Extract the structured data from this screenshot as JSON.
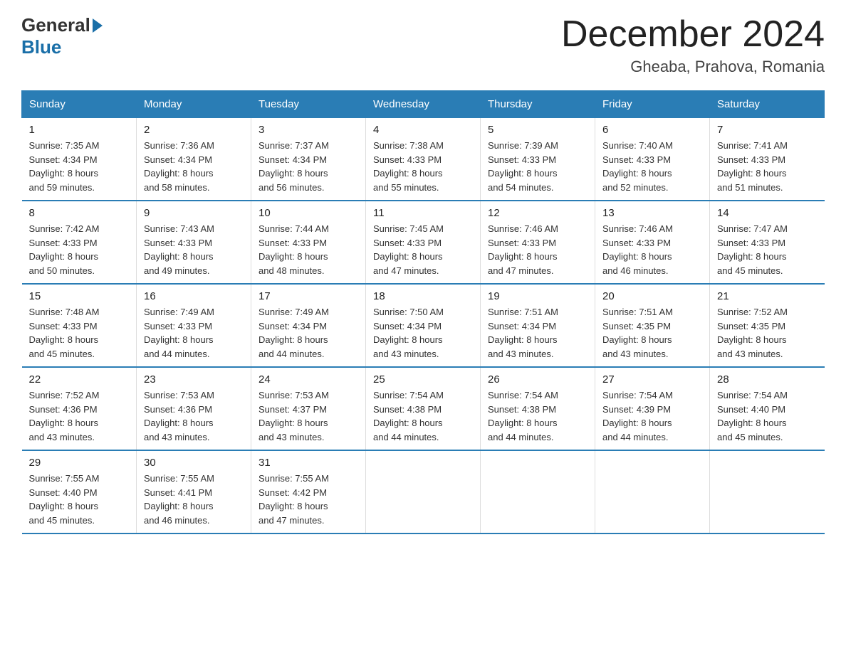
{
  "header": {
    "logo_general": "General",
    "logo_blue": "Blue",
    "month_title": "December 2024",
    "location": "Gheaba, Prahova, Romania"
  },
  "days_of_week": [
    "Sunday",
    "Monday",
    "Tuesday",
    "Wednesday",
    "Thursday",
    "Friday",
    "Saturday"
  ],
  "weeks": [
    [
      {
        "day": "1",
        "sunrise": "7:35 AM",
        "sunset": "4:34 PM",
        "daylight": "8 hours and 59 minutes."
      },
      {
        "day": "2",
        "sunrise": "7:36 AM",
        "sunset": "4:34 PM",
        "daylight": "8 hours and 58 minutes."
      },
      {
        "day": "3",
        "sunrise": "7:37 AM",
        "sunset": "4:34 PM",
        "daylight": "8 hours and 56 minutes."
      },
      {
        "day": "4",
        "sunrise": "7:38 AM",
        "sunset": "4:33 PM",
        "daylight": "8 hours and 55 minutes."
      },
      {
        "day": "5",
        "sunrise": "7:39 AM",
        "sunset": "4:33 PM",
        "daylight": "8 hours and 54 minutes."
      },
      {
        "day": "6",
        "sunrise": "7:40 AM",
        "sunset": "4:33 PM",
        "daylight": "8 hours and 52 minutes."
      },
      {
        "day": "7",
        "sunrise": "7:41 AM",
        "sunset": "4:33 PM",
        "daylight": "8 hours and 51 minutes."
      }
    ],
    [
      {
        "day": "8",
        "sunrise": "7:42 AM",
        "sunset": "4:33 PM",
        "daylight": "8 hours and 50 minutes."
      },
      {
        "day": "9",
        "sunrise": "7:43 AM",
        "sunset": "4:33 PM",
        "daylight": "8 hours and 49 minutes."
      },
      {
        "day": "10",
        "sunrise": "7:44 AM",
        "sunset": "4:33 PM",
        "daylight": "8 hours and 48 minutes."
      },
      {
        "day": "11",
        "sunrise": "7:45 AM",
        "sunset": "4:33 PM",
        "daylight": "8 hours and 47 minutes."
      },
      {
        "day": "12",
        "sunrise": "7:46 AM",
        "sunset": "4:33 PM",
        "daylight": "8 hours and 47 minutes."
      },
      {
        "day": "13",
        "sunrise": "7:46 AM",
        "sunset": "4:33 PM",
        "daylight": "8 hours and 46 minutes."
      },
      {
        "day": "14",
        "sunrise": "7:47 AM",
        "sunset": "4:33 PM",
        "daylight": "8 hours and 45 minutes."
      }
    ],
    [
      {
        "day": "15",
        "sunrise": "7:48 AM",
        "sunset": "4:33 PM",
        "daylight": "8 hours and 45 minutes."
      },
      {
        "day": "16",
        "sunrise": "7:49 AM",
        "sunset": "4:33 PM",
        "daylight": "8 hours and 44 minutes."
      },
      {
        "day": "17",
        "sunrise": "7:49 AM",
        "sunset": "4:34 PM",
        "daylight": "8 hours and 44 minutes."
      },
      {
        "day": "18",
        "sunrise": "7:50 AM",
        "sunset": "4:34 PM",
        "daylight": "8 hours and 43 minutes."
      },
      {
        "day": "19",
        "sunrise": "7:51 AM",
        "sunset": "4:34 PM",
        "daylight": "8 hours and 43 minutes."
      },
      {
        "day": "20",
        "sunrise": "7:51 AM",
        "sunset": "4:35 PM",
        "daylight": "8 hours and 43 minutes."
      },
      {
        "day": "21",
        "sunrise": "7:52 AM",
        "sunset": "4:35 PM",
        "daylight": "8 hours and 43 minutes."
      }
    ],
    [
      {
        "day": "22",
        "sunrise": "7:52 AM",
        "sunset": "4:36 PM",
        "daylight": "8 hours and 43 minutes."
      },
      {
        "day": "23",
        "sunrise": "7:53 AM",
        "sunset": "4:36 PM",
        "daylight": "8 hours and 43 minutes."
      },
      {
        "day": "24",
        "sunrise": "7:53 AM",
        "sunset": "4:37 PM",
        "daylight": "8 hours and 43 minutes."
      },
      {
        "day": "25",
        "sunrise": "7:54 AM",
        "sunset": "4:38 PM",
        "daylight": "8 hours and 44 minutes."
      },
      {
        "day": "26",
        "sunrise": "7:54 AM",
        "sunset": "4:38 PM",
        "daylight": "8 hours and 44 minutes."
      },
      {
        "day": "27",
        "sunrise": "7:54 AM",
        "sunset": "4:39 PM",
        "daylight": "8 hours and 44 minutes."
      },
      {
        "day": "28",
        "sunrise": "7:54 AM",
        "sunset": "4:40 PM",
        "daylight": "8 hours and 45 minutes."
      }
    ],
    [
      {
        "day": "29",
        "sunrise": "7:55 AM",
        "sunset": "4:40 PM",
        "daylight": "8 hours and 45 minutes."
      },
      {
        "day": "30",
        "sunrise": "7:55 AM",
        "sunset": "4:41 PM",
        "daylight": "8 hours and 46 minutes."
      },
      {
        "day": "31",
        "sunrise": "7:55 AM",
        "sunset": "4:42 PM",
        "daylight": "8 hours and 47 minutes."
      },
      null,
      null,
      null,
      null
    ]
  ],
  "labels": {
    "sunrise": "Sunrise:",
    "sunset": "Sunset:",
    "daylight": "Daylight:"
  }
}
